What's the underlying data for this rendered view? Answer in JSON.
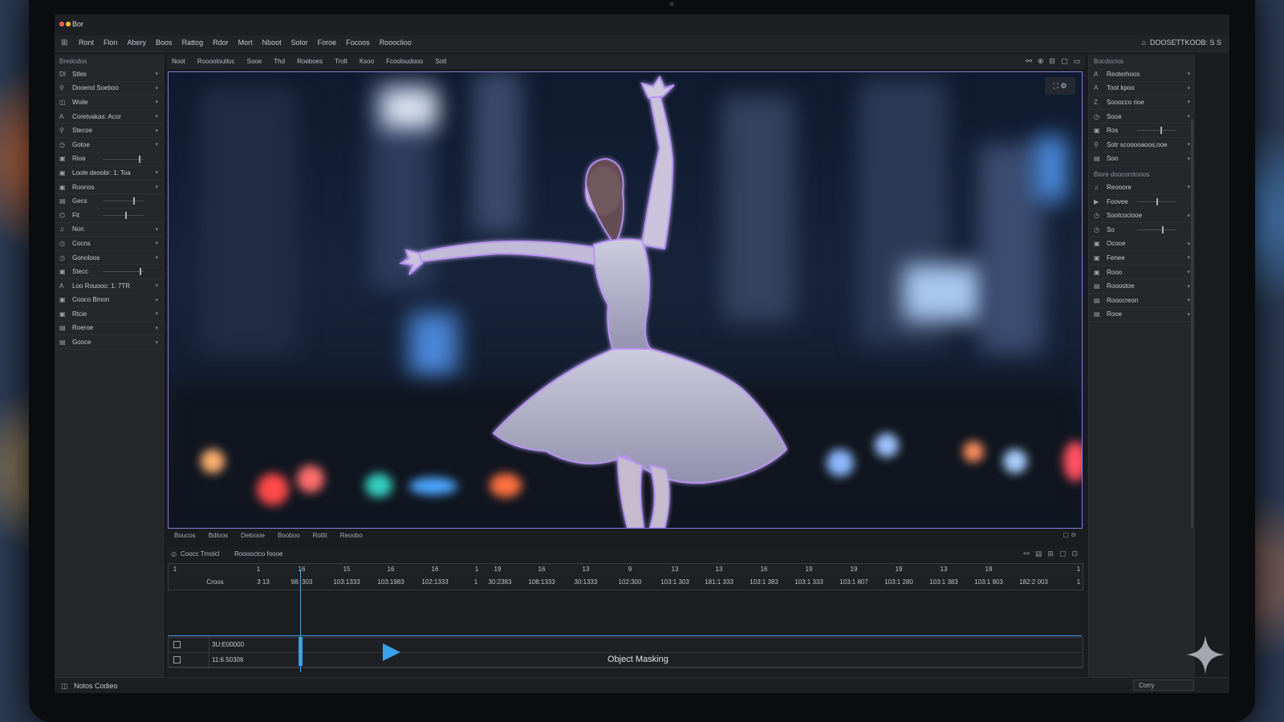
{
  "app": {
    "title": "Bor",
    "traffic_colors": [
      "#ff5f57",
      "#febc2e"
    ]
  },
  "menubar": {
    "items": [
      "Ront",
      "Flon",
      "Abery",
      "Boos",
      "Rattog",
      "Rdor",
      "Mort",
      "Nboot",
      "Solor",
      "Foroe",
      "Focoos",
      "Roooclioo"
    ],
    "right_label": "DOOSETTKOOB: S S"
  },
  "left_panel": {
    "title": "Bredodos",
    "rows": [
      {
        "icon": "DI",
        "label": "Stles"
      },
      {
        "icon": "⚲",
        "label": "Dooend Soeboo"
      },
      {
        "icon": "◫",
        "label": "Woile"
      },
      {
        "icon": "A",
        "label": "Coretvakas: Acor"
      },
      {
        "icon": "⚲",
        "label": "Stecoe"
      },
      {
        "icon": "◷",
        "label": "Gotoe"
      },
      {
        "icon": "▣",
        "label": "Rioa"
      },
      {
        "icon": "▣",
        "label": "Loole deoobr: 1: Toa"
      },
      {
        "icon": "▣",
        "label": "Roonos"
      },
      {
        "icon": "▤",
        "label": "Gecs"
      },
      {
        "icon": "⌬",
        "label": "Fit"
      },
      {
        "icon": "♫",
        "label": "Non"
      },
      {
        "icon": "◷",
        "label": "Cocns"
      },
      {
        "icon": "◷",
        "label": "Gonoloos"
      },
      {
        "icon": "▣",
        "label": "Stecc"
      },
      {
        "icon": "A",
        "label": "Loo Rouooo: 1: 7TR"
      },
      {
        "icon": "▣",
        "label": "Cooco Bmon"
      },
      {
        "icon": "▣",
        "label": "Rtcie"
      },
      {
        "icon": "▤",
        "label": "Roeroe"
      },
      {
        "icon": "▤",
        "label": "Gooce"
      }
    ]
  },
  "view_toolbar": {
    "items": [
      "Noot",
      "Rooooloutloc",
      "Sooe",
      "Thd",
      "Roeboes",
      "Trolt",
      "Ksoo",
      "Fcooloudooo",
      "Sotl"
    ]
  },
  "viewport": {
    "overlay_color": "#b58cff"
  },
  "bottom_tabs": [
    "Boucos",
    "Bdloos",
    "Deloooe",
    "Booboo",
    "Rotlit",
    "Reoobo"
  ],
  "timeline": {
    "title": "Coocc Trnoicl",
    "subtitle": "Rooooctco foooe",
    "ruler": [
      "1",
      "1",
      "16",
      "15",
      "16",
      "16",
      "1",
      "19",
      "16",
      "13",
      "9",
      "13",
      "13",
      "16",
      "19",
      "19",
      "19",
      "13",
      "19",
      "1"
    ],
    "values": [
      "Croos",
      "3 13",
      "98: 303",
      "103:1333",
      "103:1983",
      "102:1333",
      "1",
      "30:2383",
      "108:1333",
      "30:1333",
      "102:300",
      "103:1 303",
      "181:1 333",
      "103:1 383",
      "103:1 333",
      "103:1 807",
      "103:1 280",
      "103:1 383",
      "103:1 903",
      "182:2 003",
      "1"
    ],
    "tracks": [
      {
        "name": "3U:E00000"
      },
      {
        "name": "11:6.50306"
      }
    ],
    "mask_label": "Object Masking"
  },
  "right_panel": {
    "title": "Bocdocios",
    "rows": [
      {
        "icon": "A",
        "label": "Reoterhoos"
      },
      {
        "icon": "A",
        "label": "Toot kpoo"
      },
      {
        "icon": "Z",
        "label": "Sooocco rioe"
      },
      {
        "icon": "◷",
        "label": "Sooe"
      },
      {
        "icon": "▣",
        "label": "Ros"
      },
      {
        "icon": "⚲",
        "label": "Sotr scooooaoos;ooe"
      },
      {
        "icon": "▤",
        "label": "Soo"
      }
    ],
    "section2": "Biore doocorotooos",
    "rows2": [
      {
        "icon": "♫",
        "label": "Reooore"
      },
      {
        "icon": "▶",
        "label": "Foovee"
      },
      {
        "icon": "◷",
        "label": "Sootcociooe"
      },
      {
        "icon": "◷",
        "label": "So"
      },
      {
        "icon": "▣",
        "label": "Ocooe"
      },
      {
        "icon": "▣",
        "label": "Fenee"
      },
      {
        "icon": "▣",
        "label": "Rooo"
      },
      {
        "icon": "▤",
        "label": "Rooootoe"
      },
      {
        "icon": "▤",
        "label": "Rooocreon"
      },
      {
        "icon": "▤",
        "label": "Rooe"
      }
    ]
  },
  "status": {
    "text": "Notos Codieo",
    "button": "Corry"
  },
  "colors": {
    "accent": "#3ea1e0",
    "selection": "#8c7bd9"
  }
}
